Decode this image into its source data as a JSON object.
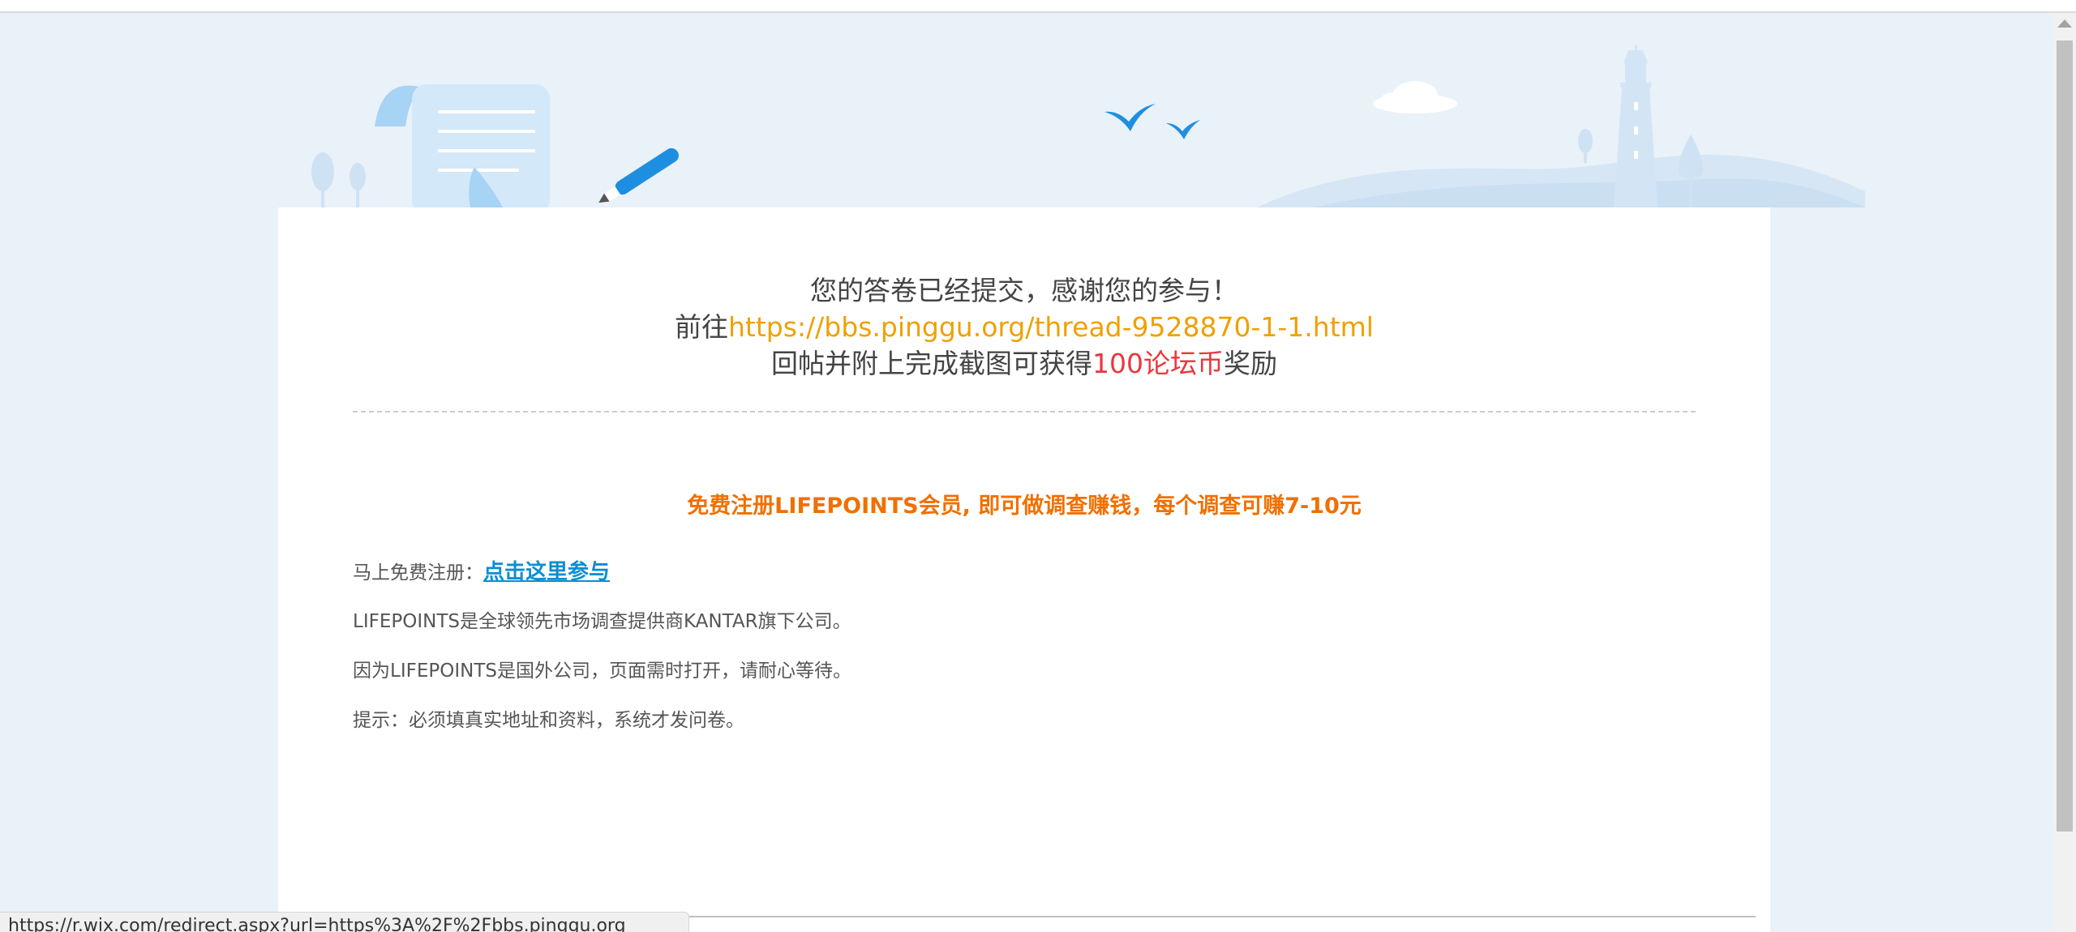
{
  "thanks": {
    "line1": "您的答卷已经提交，感谢您的参与！",
    "line2_prefix": "前往",
    "line2_url": "https://bbs.pinggu.org/thread-9528870-1-1.html",
    "line3_prefix": "回帖并附上完成截图可获得",
    "line3_reward": "100论坛币",
    "line3_suffix": "奖励"
  },
  "promo": {
    "headline": "免费注册LIFEPOINTS会员, 即可做调查赚钱，每个调查可赚7-10元",
    "register_label": "马上免费注册：",
    "register_link": "点击这里参与",
    "line_company": "LIFEPOINTS是全球领先市场调查提供商KANTAR旗下公司。",
    "line_wait": "因为LIFEPOINTS是国外公司，页面需时打开，请耐心等待。",
    "line_tip": "提示：必须填真实地址和资料，系统才发问卷。"
  },
  "status_bar": {
    "url": "https://r.wix.com/redirect.aspx?url=https%3A%2F%2Fbbs.pinggu.org"
  },
  "colors": {
    "background": "#e9f1f9",
    "link_orange": "#f0a000",
    "reward_red": "#e8383d",
    "promo_orange": "#f07000",
    "register_blue": "#0a8ed1"
  },
  "icons": {
    "banner": "survey-scroll-pen-lighthouse-illustration"
  }
}
